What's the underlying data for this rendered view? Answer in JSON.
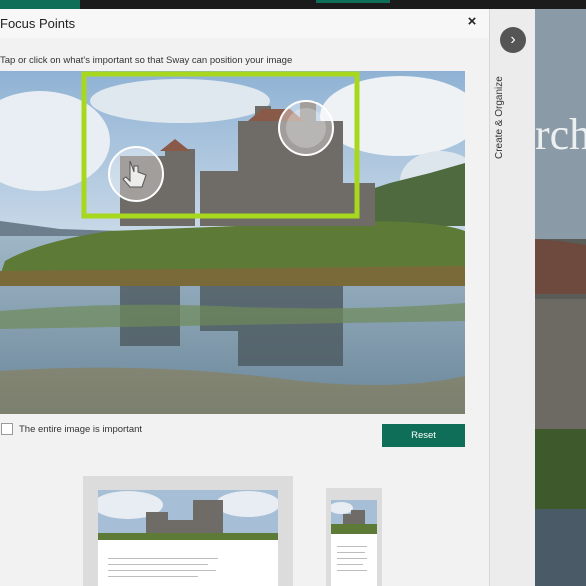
{
  "dialog": {
    "title": "Focus Points",
    "close_icon": "×",
    "instruction": "Tap or click on what's important so that Sway can position your image",
    "checkbox_label": "The entire image is important",
    "checkbox_checked": false,
    "reset_label": "Reset"
  },
  "side_panel": {
    "label": "Create & Organize",
    "next_icon": "chevron-right-icon"
  },
  "background": {
    "heading_fragment": "rch"
  },
  "colors": {
    "accent": "#0e6e57",
    "focus_frame": "#a8d81e"
  }
}
